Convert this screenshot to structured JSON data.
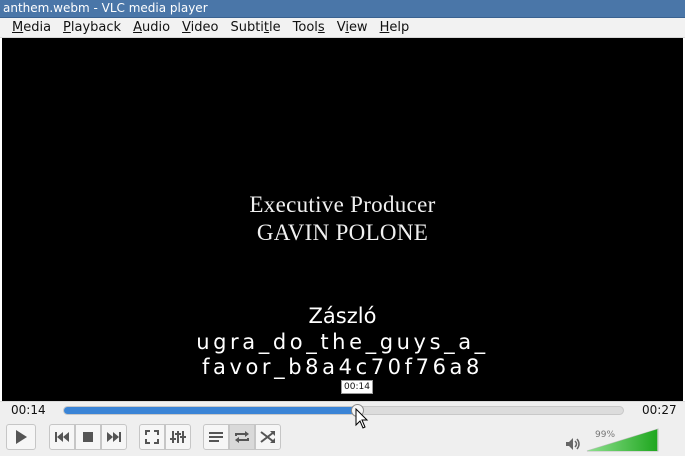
{
  "window": {
    "title": "anthem.webm - VLC media player"
  },
  "menu": [
    {
      "pre": "",
      "u": "M",
      "post": "edia"
    },
    {
      "pre": "",
      "u": "P",
      "post": "layback"
    },
    {
      "pre": "",
      "u": "A",
      "post": "udio"
    },
    {
      "pre": "",
      "u": "V",
      "post": "ideo"
    },
    {
      "pre": "Subti",
      "u": "t",
      "post": "le"
    },
    {
      "pre": "Tool",
      "u": "s",
      "post": ""
    },
    {
      "pre": "V",
      "u": "i",
      "post": "ew"
    },
    {
      "pre": "",
      "u": "H",
      "post": "elp"
    }
  ],
  "video": {
    "credit_role": "Executive Producer",
    "credit_name": "GAVIN POLONE",
    "subtitle_line1": "Zászló",
    "subtitle_line2": "ugra_do_the_guys_a_",
    "subtitle_line3": "favor_b8a4c70f76a8"
  },
  "playback": {
    "elapsed": "00:14",
    "total": "00:27",
    "hover_time": "00:14",
    "progress_fraction": 0.52
  },
  "volume": {
    "label": "99%",
    "level_fraction": 0.99
  },
  "icons": {
    "play": "play-icon",
    "previous": "previous-icon",
    "stop": "stop-icon",
    "next": "next-icon",
    "fullscreen": "fullscreen-icon",
    "extended_settings": "equalizer-icon",
    "playlist": "playlist-icon",
    "loop": "loop-icon",
    "shuffle": "shuffle-icon",
    "volume": "speaker-icon"
  },
  "colors": {
    "titlebar": "#4a76a8",
    "seek_fill": "#3a84d6",
    "volume_fill": "#2dbd2d"
  }
}
